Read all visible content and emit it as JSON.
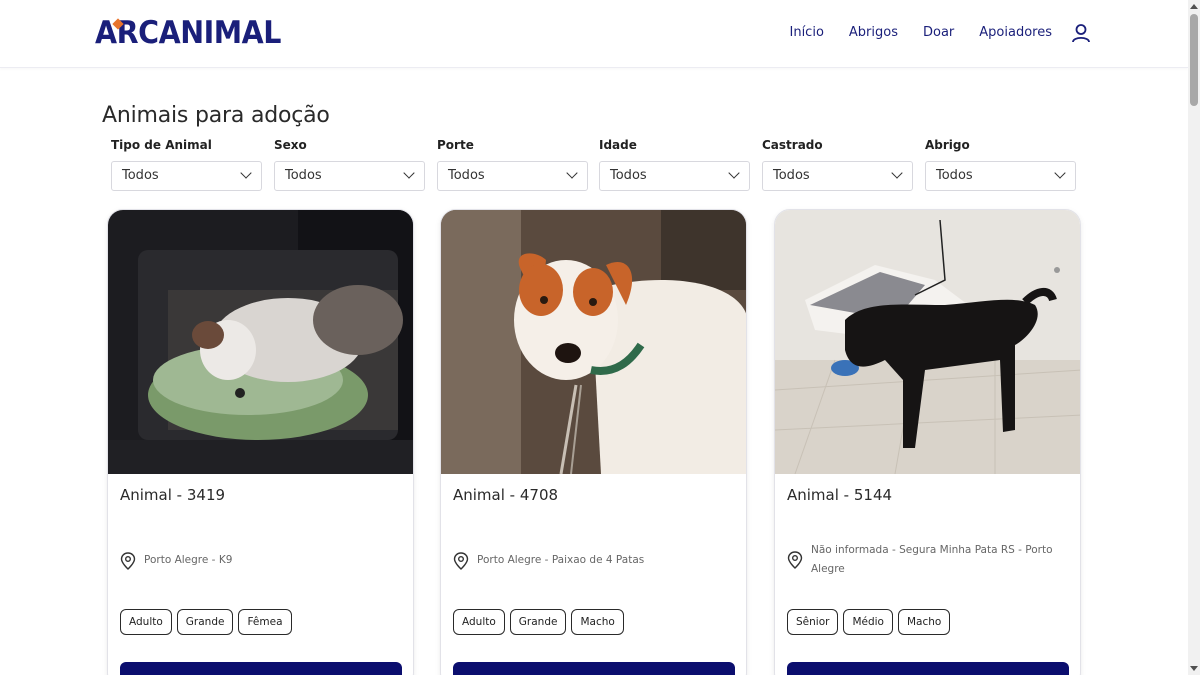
{
  "header": {
    "logo_text": "ARCANIMAL",
    "nav": [
      "Início",
      "Abrigos",
      "Doar",
      "Apoiadores"
    ],
    "user_icon": "user-icon"
  },
  "page": {
    "title": "Animais para adoção"
  },
  "filters": [
    {
      "label": "Tipo de Animal",
      "value": "Todos"
    },
    {
      "label": "Sexo",
      "value": "Todos"
    },
    {
      "label": "Porte",
      "value": "Todos"
    },
    {
      "label": "Idade",
      "value": "Todos"
    },
    {
      "label": "Castrado",
      "value": "Todos"
    },
    {
      "label": "Abrigo",
      "value": "Todos"
    }
  ],
  "cards": [
    {
      "title": "Animal - 3419",
      "location": "Porto Alegre - K9",
      "tags": [
        "Adulto",
        "Grande",
        "Fêmea"
      ],
      "photo": "white-brown dog lying on green cushion in dark kennel"
    },
    {
      "title": "Animal - 4708",
      "location": "Porto Alegre - Paixao de 4 Patas",
      "tags": [
        "Adulto",
        "Grande",
        "Macho"
      ],
      "photo": "white dog with orange ears and green collar"
    },
    {
      "title": "Animal - 5144",
      "location": "Não informada - Segura Minha Pata RS - Porto Alegre",
      "tags": [
        "Sênior",
        "Médio",
        "Macho"
      ],
      "photo": "black dog standing on tiled floor"
    }
  ],
  "colors": {
    "brand": "#1a1f7a",
    "accent": "#e8742c",
    "button": "#0b0e6e"
  }
}
